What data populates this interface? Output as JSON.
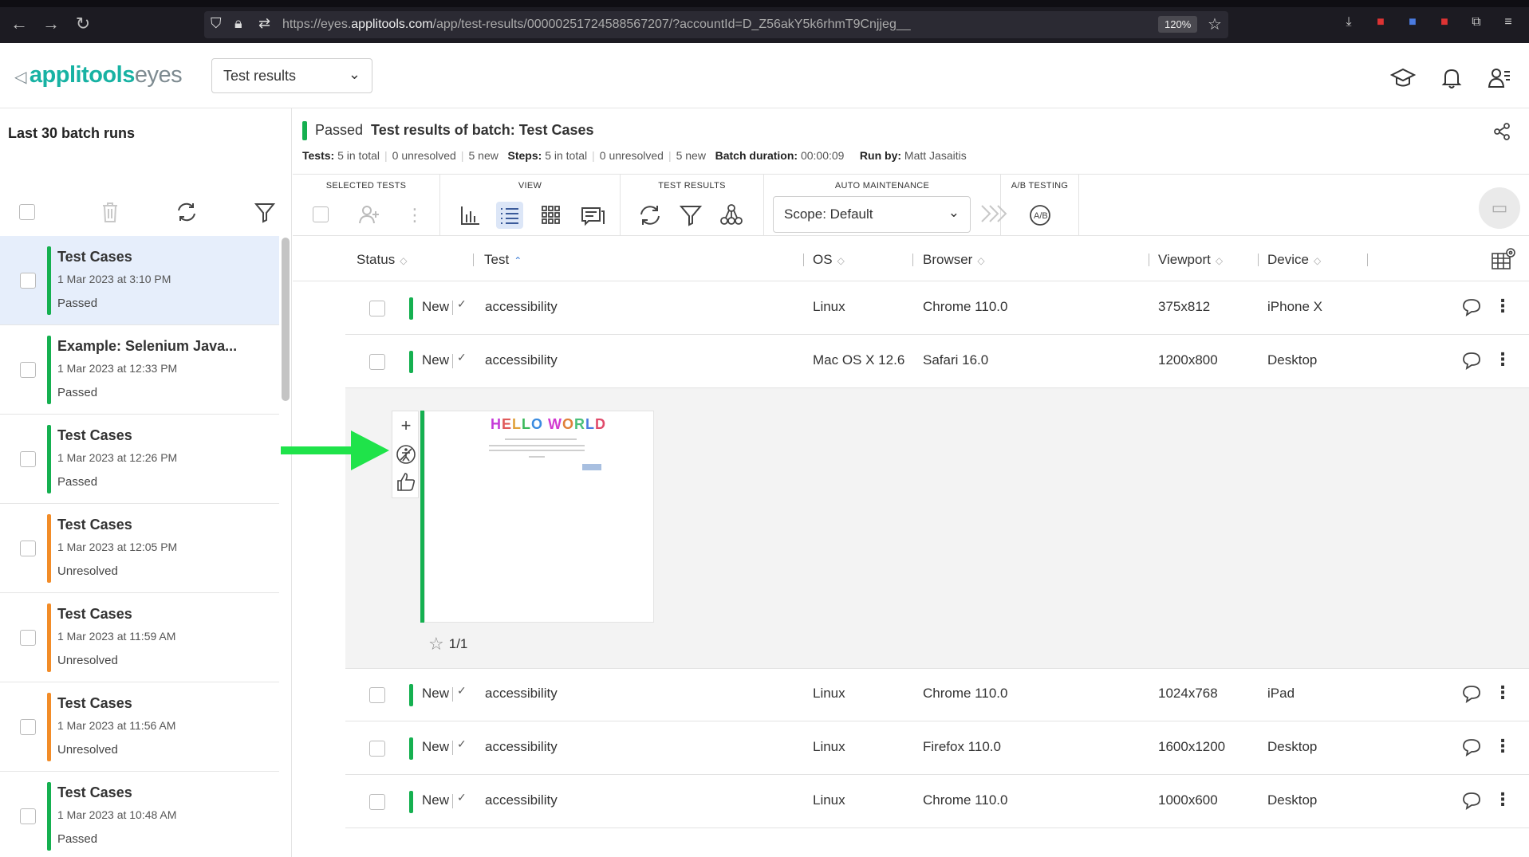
{
  "browser": {
    "url_prefix": "https://eyes.",
    "url_domain": "applitools.com",
    "url_rest": "/app/test-results/00000251724588567207/?accountId=D_Z56akY5k6rhmT9Cnjjeg__",
    "zoom": "120%"
  },
  "header": {
    "logo_a": "applitools",
    "logo_b": "eyes",
    "page_select": "Test results"
  },
  "sidebar": {
    "title": "Last 30 batch runs",
    "batches": [
      {
        "title": "Test Cases",
        "date": "1 Mar 2023 at 3:10 PM",
        "status": "Passed",
        "color": "#15b050",
        "selected": true
      },
      {
        "title": "Example: Selenium Java...",
        "date": "1 Mar 2023 at 12:33 PM",
        "status": "Passed",
        "color": "#15b050"
      },
      {
        "title": "Test Cases",
        "date": "1 Mar 2023 at 12:26 PM",
        "status": "Passed",
        "color": "#15b050"
      },
      {
        "title": "Test Cases",
        "date": "1 Mar 2023 at 12:05 PM",
        "status": "Unresolved",
        "color": "#f28c28"
      },
      {
        "title": "Test Cases",
        "date": "1 Mar 2023 at 11:59 AM",
        "status": "Unresolved",
        "color": "#f28c28"
      },
      {
        "title": "Test Cases",
        "date": "1 Mar 2023 at 11:56 AM",
        "status": "Unresolved",
        "color": "#f28c28"
      },
      {
        "title": "Test Cases",
        "date": "1 Mar 2023 at 10:48 AM",
        "status": "Passed",
        "color": "#15b050"
      }
    ]
  },
  "batch": {
    "status": "Passed",
    "title_label": "Test results of batch:",
    "title_value": "Test Cases",
    "tests_label": "Tests:",
    "tests_total": "5 in total",
    "tests_unresolved": "0 unresolved",
    "tests_new": "5 new",
    "steps_label": "Steps:",
    "steps_total": "5 in total",
    "steps_unresolved": "0 unresolved",
    "steps_new": "5 new",
    "duration_label": "Batch duration:",
    "duration": "00:00:09",
    "runby_label": "Run by:",
    "runby": "Matt Jasaitis"
  },
  "toolbar": {
    "selected_tests": "SELECTED TESTS",
    "view": "VIEW",
    "test_results": "TEST RESULTS",
    "auto_maintenance": "AUTO MAINTENANCE",
    "ab_testing": "A/B TESTING",
    "scope": "Scope: Default"
  },
  "table": {
    "columns": {
      "status": "Status",
      "test": "Test",
      "os": "OS",
      "browser": "Browser",
      "viewport": "Viewport",
      "device": "Device"
    },
    "rows": [
      {
        "status": "New",
        "test": "accessibility",
        "os": "Linux",
        "browser": "Chrome 110.0",
        "viewport": "375x812",
        "device": "iPhone X"
      },
      {
        "status": "New",
        "test": "accessibility",
        "os": "Mac OS X 12.6",
        "browser": "Safari 16.0",
        "viewport": "1200x800",
        "device": "Desktop"
      },
      {
        "status": "New",
        "test": "accessibility",
        "os": "Linux",
        "browser": "Chrome 110.0",
        "viewport": "1024x768",
        "device": "iPad"
      },
      {
        "status": "New",
        "test": "accessibility",
        "os": "Linux",
        "browser": "Firefox 110.0",
        "viewport": "1600x1200",
        "device": "Desktop"
      },
      {
        "status": "New",
        "test": "accessibility",
        "os": "Linux",
        "browser": "Chrome 110.0",
        "viewport": "1000x600",
        "device": "Desktop"
      }
    ]
  },
  "expanded": {
    "thumbnail_heading": "HELLO WORLD",
    "step_counter": "1/1"
  }
}
